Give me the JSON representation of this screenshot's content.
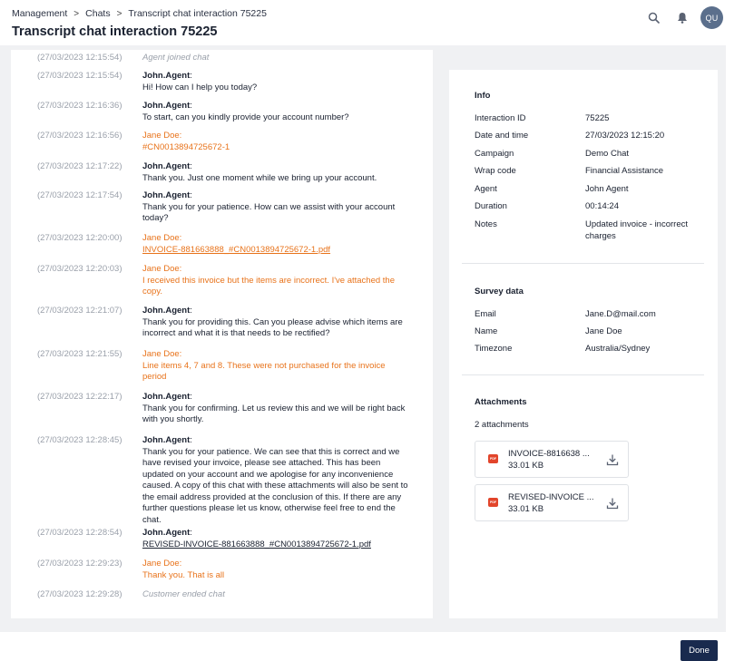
{
  "breadcrumb": {
    "items": [
      "Management",
      "Chats",
      "Transcript chat interaction 75225"
    ],
    "separator": ">"
  },
  "page": {
    "title": "Transcript chat interaction 75225"
  },
  "header": {
    "avatar_initials": "QU"
  },
  "transcript": [
    {
      "time": "(27/03/2023 12:15:54)",
      "type": "system",
      "text": "Agent joined chat"
    },
    {
      "time": "(27/03/2023 12:15:54)",
      "type": "agent",
      "author": "John.Agent",
      "text": "Hi! How can I help you today?"
    },
    {
      "time": "(27/03/2023 12:16:36)",
      "type": "agent",
      "author": "John.Agent",
      "text": "To start, can you kindly provide your account number?"
    },
    {
      "time": "(27/03/2023 12:16:56)",
      "type": "user",
      "author": "Jane Doe",
      "text": "#CN0013894725672-1"
    },
    {
      "time": "(27/03/2023 12:17:22)",
      "type": "agent",
      "author": "John.Agent",
      "text": "Thank you. Just one moment while we bring up your account."
    },
    {
      "time": "(27/03/2023 12:17:54)",
      "type": "agent",
      "author": "John.Agent",
      "text": "Thank you for your patience. How can we assist with your account today?"
    },
    {
      "time": "(27/03/2023 12:20:00)",
      "type": "user",
      "author": "Jane Doe",
      "text": "INVOICE-881663888_#CN0013894725672-1.pdf",
      "link": true
    },
    {
      "time": "(27/03/2023 12:20:03)",
      "type": "user",
      "author": "Jane Doe",
      "text": "I received this invoice but the items are incorrect. I've attached the copy."
    },
    {
      "time": "(27/03/2023 12:21:07)",
      "type": "agent",
      "author": "John.Agent",
      "text": "Thank you for providing this. Can you please advise which items are incorrect and what it is that needs to be rectified?"
    },
    {
      "time": "(27/03/2023 12:21:55)",
      "type": "user",
      "author": "Jane Doe",
      "text": "Line items 4, 7 and 8. These were not purchased for the invoice period"
    },
    {
      "time": "(27/03/2023 12:22:17)",
      "type": "agent",
      "author": "John.Agent",
      "text": "Thank you for confirming. Let us review this and we will be right back with you shortly."
    },
    {
      "time": "(27/03/2023 12:28:45)",
      "type": "agent",
      "author": "John.Agent",
      "text": "Thank you for your patience. We can see that this is correct and we have revised your invoice, please see attached. This has been updated on your account and we apologise for any inconvenience caused. A copy of this chat with these attachments will also be sent to the email address provided at the conclusion of this. If there are any further questions please let us know, otherwise feel free to end the chat."
    },
    {
      "time": "(27/03/2023 12:28:54)",
      "type": "agent",
      "author": "John.Agent",
      "text": "REVISED-INVOICE-881663888_#CN0013894725672-1.pdf",
      "link": true
    },
    {
      "time": "(27/03/2023 12:29:23)",
      "type": "user",
      "author": "Jane Doe",
      "text": "Thank you. That is all"
    },
    {
      "time": "(27/03/2023 12:29:28)",
      "type": "system",
      "text": "Customer ended chat"
    }
  ],
  "info": {
    "title": "Info",
    "rows": [
      {
        "label": "Interaction ID",
        "value": "75225"
      },
      {
        "label": "Date and time",
        "value": "27/03/2023 12:15:20"
      },
      {
        "label": "Campaign",
        "value": "Demo Chat"
      },
      {
        "label": "Wrap code",
        "value": "Financial Assistance"
      },
      {
        "label": "Agent",
        "value": "John Agent"
      },
      {
        "label": "Duration",
        "value": "00:14:24"
      },
      {
        "label": "Notes",
        "value": "Updated invoice - incorrect charges"
      }
    ]
  },
  "survey": {
    "title": "Survey data",
    "rows": [
      {
        "label": "Email",
        "value": "Jane.D@mail.com"
      },
      {
        "label": "Name",
        "value": "Jane Doe"
      },
      {
        "label": "Timezone",
        "value": "Australia/Sydney"
      }
    ]
  },
  "attachments": {
    "title": "Attachments",
    "count_label": "2 attachments",
    "items": [
      {
        "name": "INVOICE-8816638 ...",
        "size": "33.01 KB",
        "icon": "pdf-icon",
        "badge": "PDF"
      },
      {
        "name": "REVISED-INVOICE ...",
        "size": "33.01 KB",
        "icon": "pdf-icon",
        "badge": "PDF"
      }
    ]
  },
  "footer": {
    "done_label": "Done"
  },
  "colors": {
    "accent": "#192a4e",
    "customer": "#e8731b",
    "muted": "#9aa0aa",
    "background": "#f0f1f3",
    "avatar": "#5b6f8c"
  }
}
